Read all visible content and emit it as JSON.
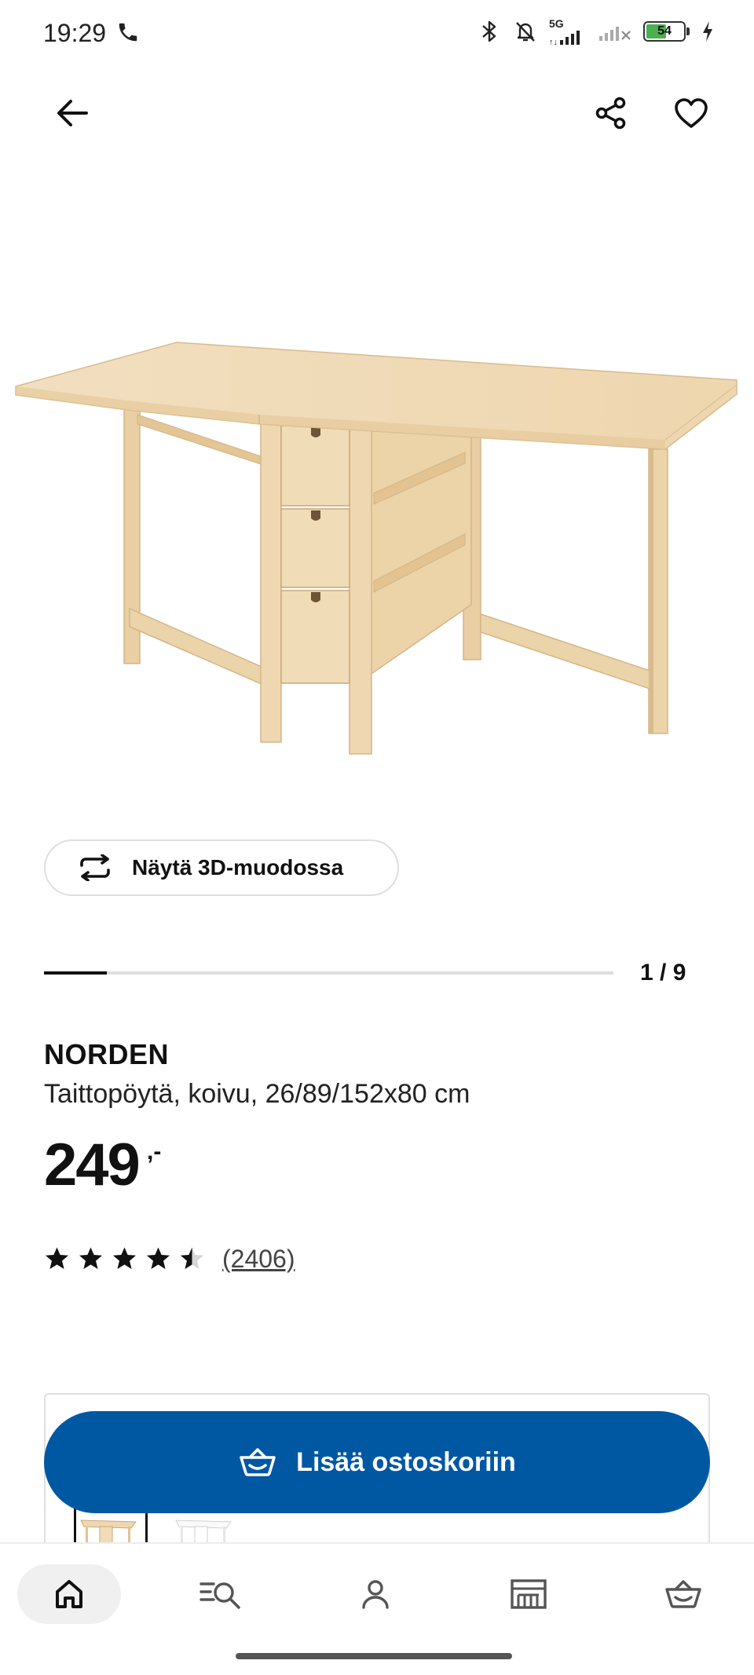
{
  "status_bar": {
    "time": "19:29",
    "network_label": "5G",
    "battery_level": "54",
    "battery_percent": 54,
    "icons": [
      "phone-icon",
      "bluetooth-icon",
      "bell-muted-icon",
      "signal-icon",
      "signal-weak-icon",
      "battery-icon",
      "charging-icon"
    ]
  },
  "top_bar": {
    "icons": [
      "back-arrow-icon",
      "share-icon",
      "heart-icon"
    ]
  },
  "gallery": {
    "view_3d_label": "Näytä 3D-muodossa",
    "counter": "1 / 9",
    "progress": 0.11
  },
  "product": {
    "name": "NORDEN",
    "description": "Taittopöytä, koivu, 26/89/152x80 cm",
    "price": "249",
    "price_suffix": ",-",
    "rating_value": 4.5,
    "rating_max": 5,
    "rating_count": "(2406)"
  },
  "cart_button": {
    "label": "Lisää ostoskoriin",
    "icon": "basket-icon"
  },
  "bottom_nav": {
    "items": [
      "home-icon",
      "search-list-icon",
      "profile-icon",
      "store-icon",
      "basket-icon"
    ],
    "active": "home-icon"
  },
  "colors": {
    "brand_blue": "#0058a3",
    "text": "#111111",
    "wood": "#efd9b4",
    "border": "#dfdfdf"
  }
}
